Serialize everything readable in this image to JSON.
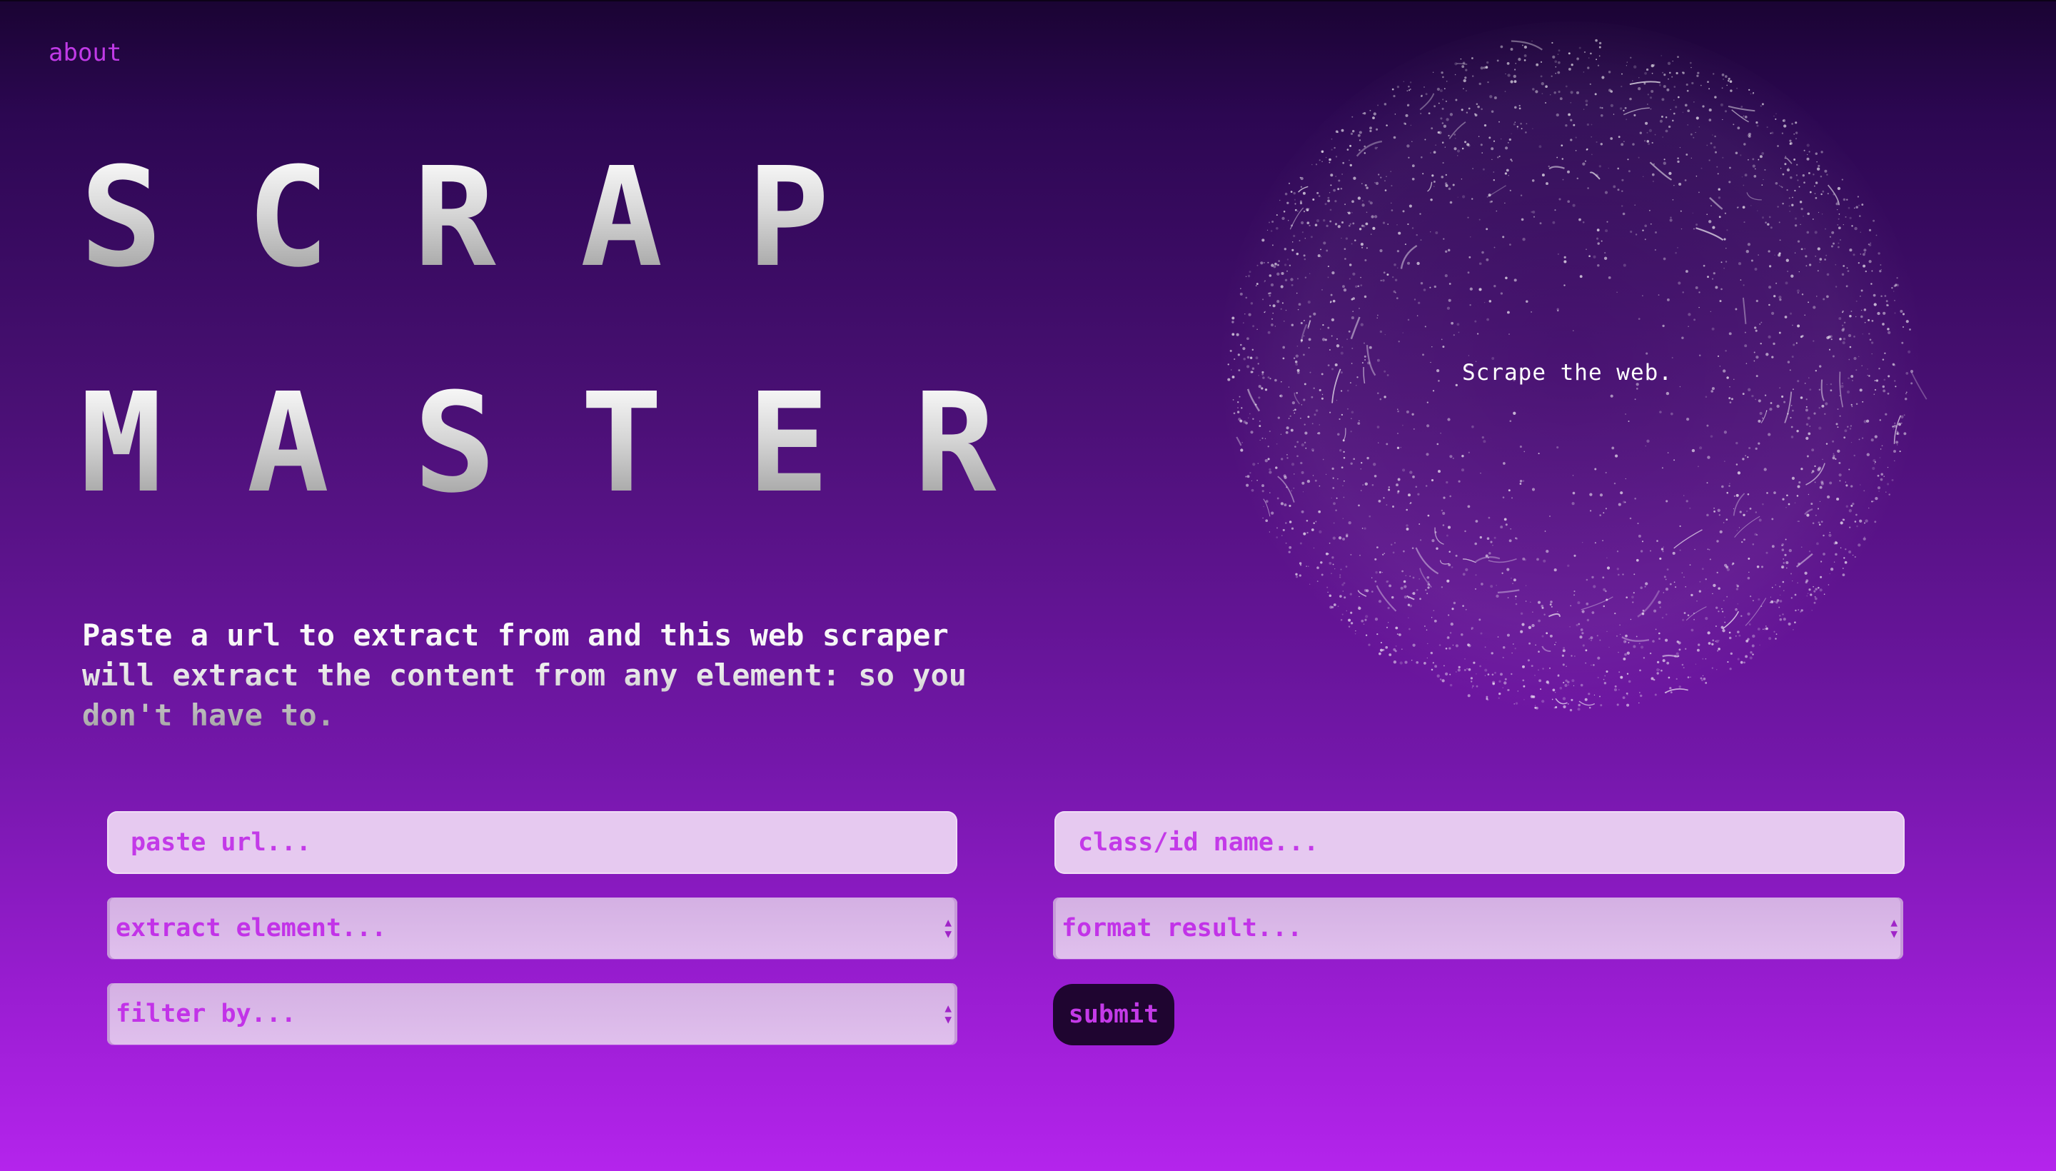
{
  "nav": {
    "about_label": "about"
  },
  "hero": {
    "title_line1": "SCRAP",
    "title_line2": "MASTER",
    "tagline": "Paste a url to extract from and this web scraper will extract the content from any element: so you don't have to."
  },
  "globe": {
    "caption": "Scrape the web."
  },
  "form": {
    "url_placeholder": "paste url...",
    "class_placeholder": "class/id name...",
    "extract_element_label": "extract element...",
    "format_result_label": "format result...",
    "filter_by_label": "filter by...",
    "submit_label": "submit",
    "caret_icon": "updown-arrows-icon"
  },
  "colors": {
    "accent": "#c233e8",
    "field_bg": "#e6c9f0",
    "submit_bg": "#1f0530",
    "background_top": "#1a0433",
    "background_bottom": "#b424ec"
  }
}
